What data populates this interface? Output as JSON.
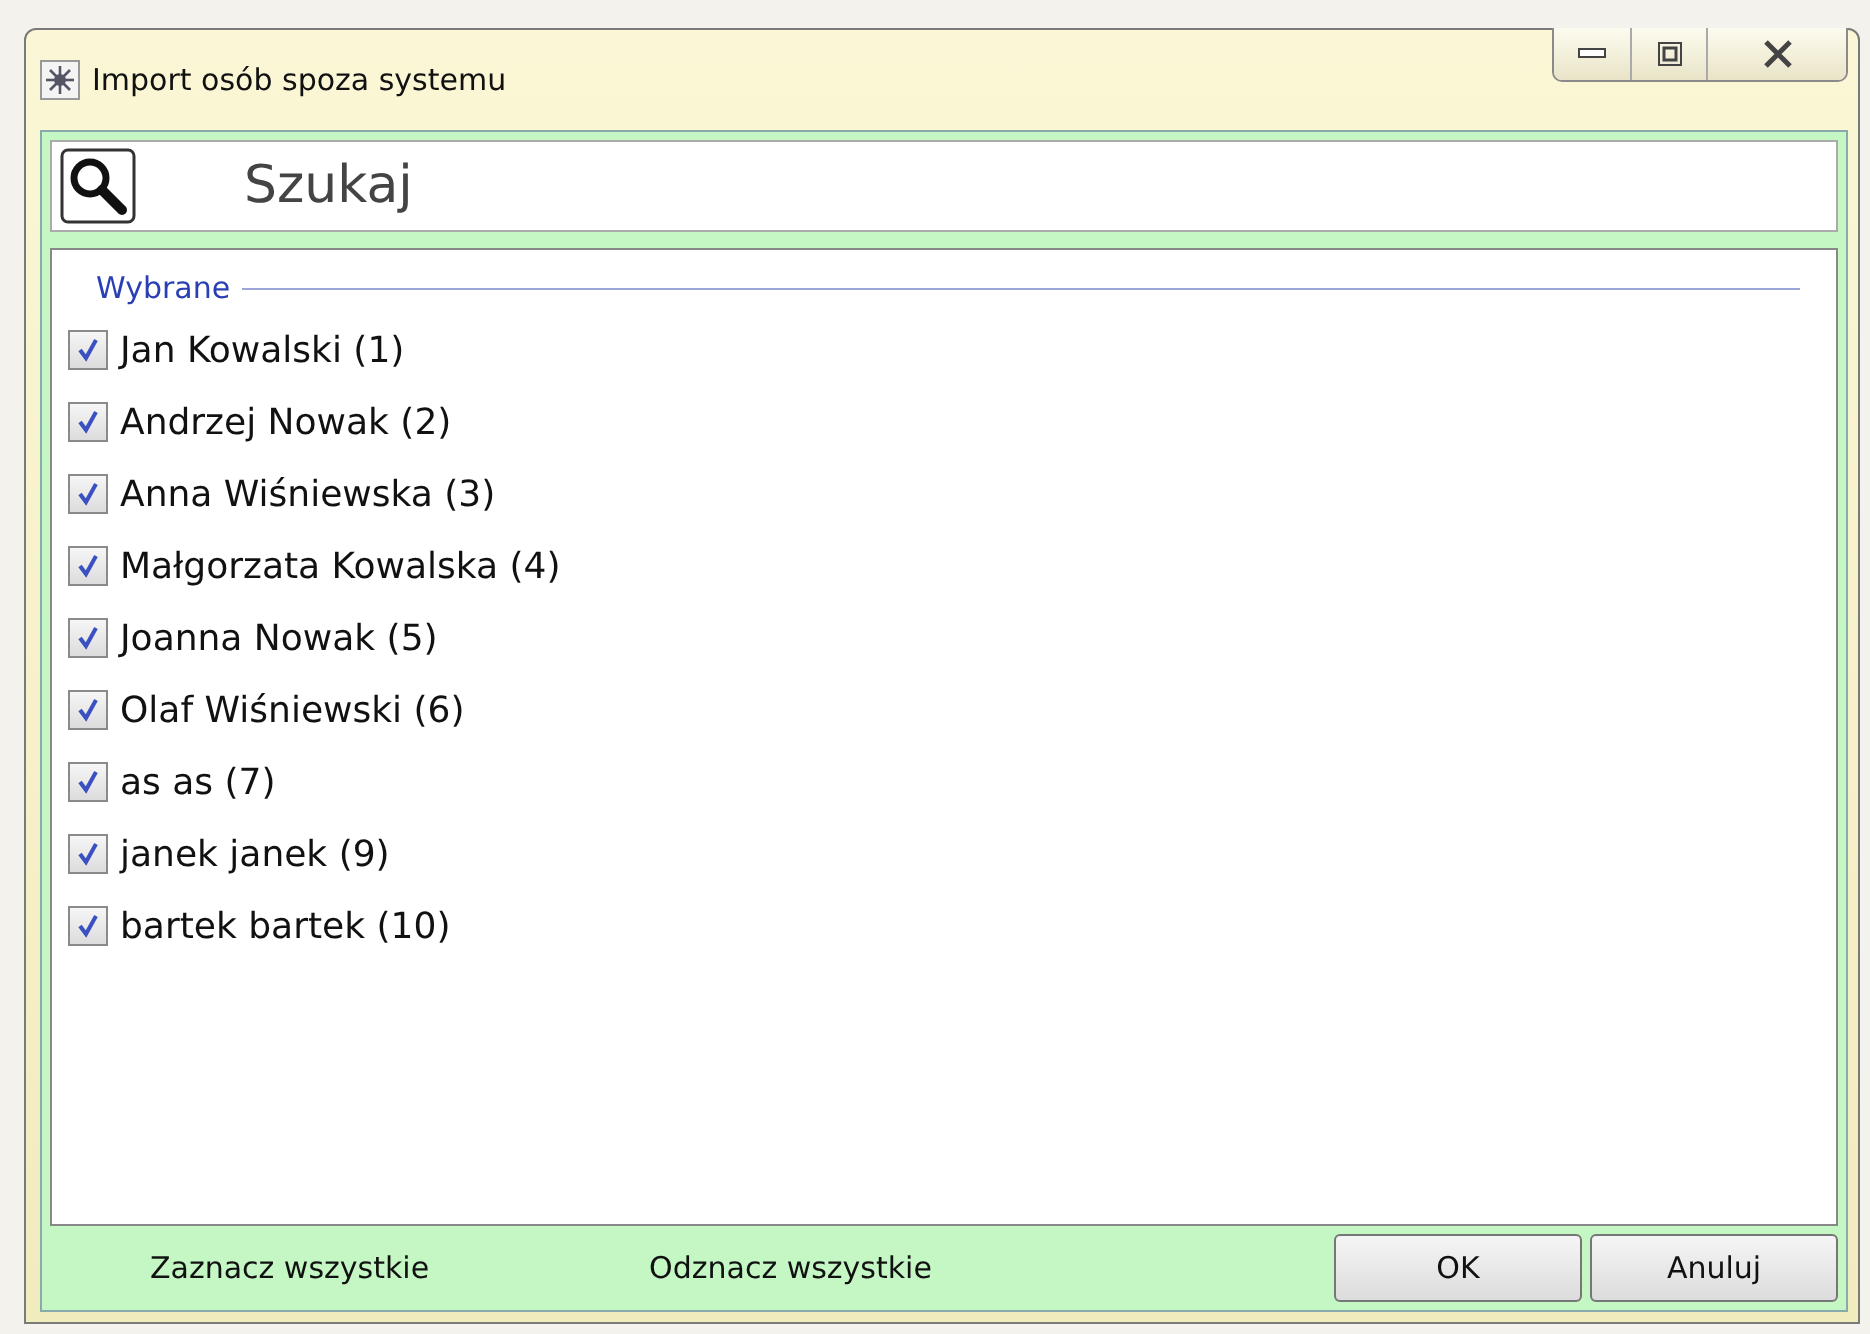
{
  "window": {
    "title": "Import osób spoza systemu"
  },
  "search": {
    "placeholder": "Szukaj"
  },
  "group": {
    "title": "Wybrane"
  },
  "people": [
    {
      "label": "Jan Kowalski (1)",
      "checked": true
    },
    {
      "label": "Andrzej Nowak (2)",
      "checked": true
    },
    {
      "label": "Anna Wiśniewska (3)",
      "checked": true
    },
    {
      "label": "Małgorzata Kowalska (4)",
      "checked": true
    },
    {
      "label": "Joanna Nowak (5)",
      "checked": true
    },
    {
      "label": "Olaf Wiśniewski (6)",
      "checked": true
    },
    {
      "label": "as as (7)",
      "checked": true
    },
    {
      "label": "janek janek (9)",
      "checked": true
    },
    {
      "label": "bartek bartek (10)",
      "checked": true
    }
  ],
  "links": [
    "Zaznacz wszystkie",
    "Odznacz wszystkie"
  ],
  "buttons": [
    "OK",
    "Anuluj"
  ]
}
